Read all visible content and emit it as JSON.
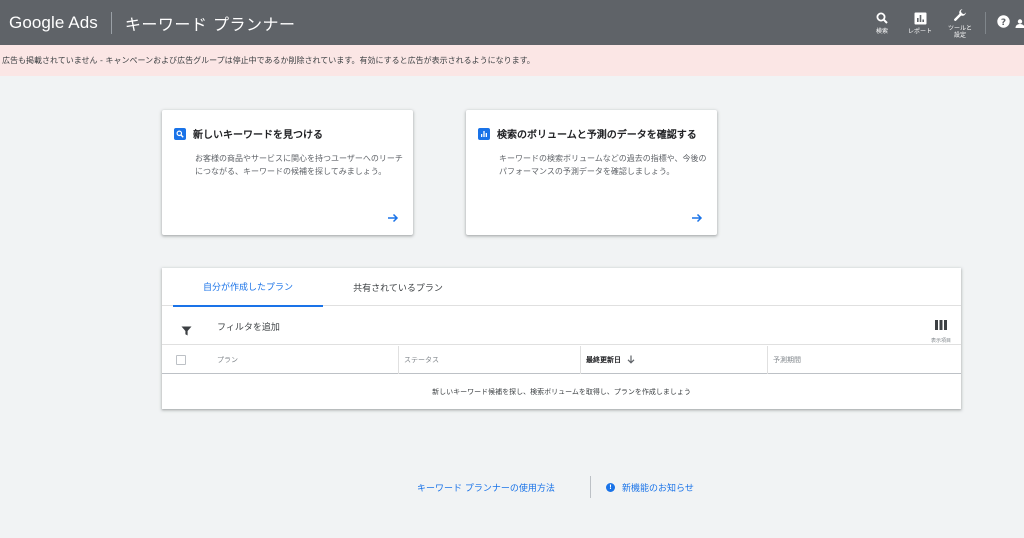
{
  "header": {
    "brand": "Google Ads",
    "page_title": "キーワード プランナー",
    "tools": [
      {
        "label": "検索",
        "icon": "search-icon"
      },
      {
        "label": "レポート",
        "icon": "report-icon"
      },
      {
        "label": "ツールと\n設定",
        "icon": "wrench-icon"
      }
    ],
    "help_icon": "help-icon"
  },
  "alert": {
    "text": "広告も掲載されていません - キャンペーンおよび広告グループは停止中であるか削除されています。有効にすると広告が表示されるようになります。"
  },
  "cards": [
    {
      "title": "新しいキーワードを見つける",
      "description": "お客様の商品やサービスに関心を持つユーザーへのリーチにつながる、キーワードの候補を探してみましょう。",
      "icon": "search-icon"
    },
    {
      "title": "検索のボリュームと予測のデータを確認する",
      "description": "キーワードの検索ボリュームなどの過去の指標や、今後のパフォーマンスの予測データを確認しましょう。",
      "icon": "chart-icon"
    }
  ],
  "plans": {
    "tabs": [
      "自分が作成したプラン",
      "共有されているプラン"
    ],
    "active_tab": 0,
    "filter_label": "フィルタを追加",
    "columns_label": "表示項目",
    "table_headers": [
      "プラン",
      "ステータス",
      "最終更新日",
      "予測期間"
    ],
    "sorted_column": "最終更新日",
    "empty_message": "新しいキーワード候補を探し、検索ボリュームを取得し、プランを作成しましょう"
  },
  "footer": {
    "help_link": "キーワード プランナーの使用方法",
    "news_link": "新機能のお知らせ"
  },
  "colors": {
    "header_bg": "#5f6368",
    "accent": "#1a73e8",
    "alert_bg": "#fbe6e5",
    "page_bg": "#f1f3f4"
  }
}
